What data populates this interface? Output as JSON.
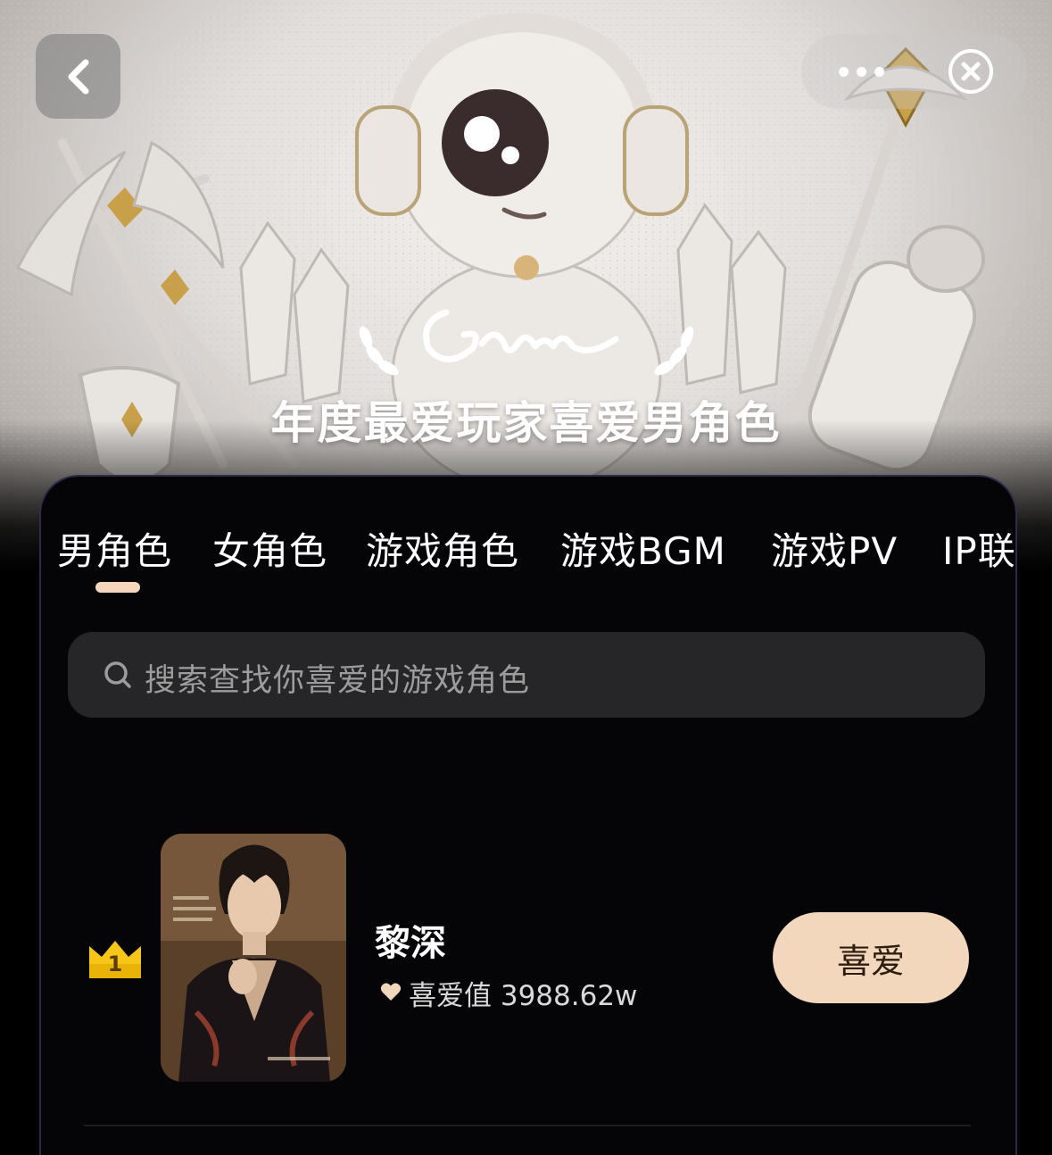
{
  "hero": {
    "title": "年度最爱玩家喜爱男角色",
    "logo_text": "Game"
  },
  "topbar": {
    "back_icon": "chevron-left-icon",
    "more_icon": "more-dots-icon",
    "close_icon": "close-circle-icon"
  },
  "tabs": [
    {
      "label": "男角色",
      "active": true
    },
    {
      "label": "女角色",
      "active": false
    },
    {
      "label": "游戏角色",
      "active": false
    },
    {
      "label": "游戏BGM",
      "active": false
    },
    {
      "label": "游戏PV",
      "active": false
    },
    {
      "label": "IP联",
      "active": false
    }
  ],
  "search": {
    "placeholder": "搜索查找你喜爱的游戏角色",
    "icon": "search-icon"
  },
  "list": [
    {
      "rank": "1",
      "name": "黎深",
      "score_label": "喜爱值 3988.62w",
      "action_label": "喜爱"
    }
  ],
  "colors": {
    "accent": "#f2d7bc",
    "panel_bg": "#050508",
    "panel_border": "#2f2c4a",
    "search_bg": "#262628",
    "rank_gold": "#f5c518"
  }
}
